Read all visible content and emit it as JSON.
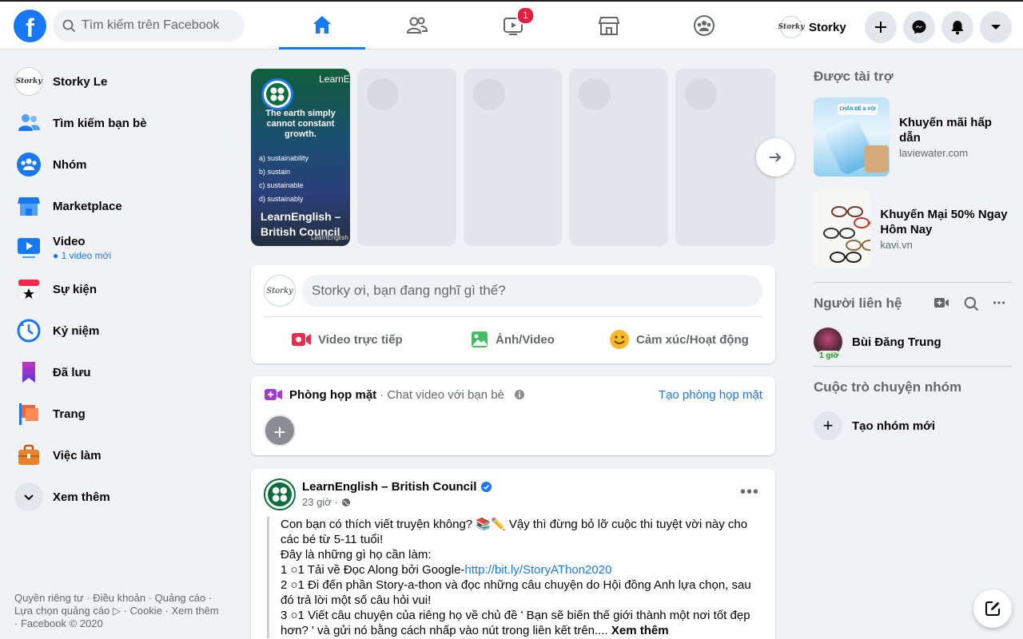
{
  "header": {
    "logo": "f",
    "search_placeholder": "Tìm kiếm trên Facebook",
    "watch_badge": "1",
    "profile_name": "Storky",
    "avatar_text": "Storky"
  },
  "left_nav": {
    "items": [
      {
        "label": "Storky Le",
        "icon": "avatar"
      },
      {
        "label": "Tìm kiếm bạn bè",
        "icon": "friends-icon"
      },
      {
        "label": "Nhóm",
        "icon": "groups-icon"
      },
      {
        "label": "Marketplace",
        "icon": "marketplace-icon"
      },
      {
        "label": "Video",
        "icon": "video-icon",
        "sub": "1 video mới"
      },
      {
        "label": "Sự kiện",
        "icon": "events-icon"
      },
      {
        "label": "Kỷ niệm",
        "icon": "memories-icon"
      },
      {
        "label": "Đã lưu",
        "icon": "saved-icon"
      },
      {
        "label": "Trang",
        "icon": "pages-icon"
      },
      {
        "label": "Việc làm",
        "icon": "jobs-icon"
      },
      {
        "label": "Xem thêm",
        "icon": "chevron-down-icon"
      }
    ],
    "footer": "Quyền riêng tư · Điều khoản · Quảng cáo · Lựa chọn quảng cáo ▷ · Cookie · Xem thêm · Facebook © 2020"
  },
  "stories": {
    "first": {
      "title": "LearnEnglish – British Council",
      "brand_text": "LearnE",
      "top_text": "The earth simply cannot constant growth.",
      "options": [
        "a) sustainability",
        "b) sustain",
        "c) sustainable",
        "d) sustainably"
      ],
      "small_brand": "LearnEnglish"
    }
  },
  "composer": {
    "placeholder": "Storky ơi, bạn đang nghĩ gì thế?",
    "live": "Video trực tiếp",
    "photo": "Ảnh/Video",
    "feeling": "Cảm xúc/Hoạt động"
  },
  "rooms": {
    "title": "Phòng họp mặt",
    "subtitle": "· Chat video với bạn bè",
    "create": "Tạo phòng họp mặt"
  },
  "post": {
    "author": "LearnEnglish – British Council",
    "time": "23 giờ ·",
    "line1": "Con bạn có thích viết truyện không? 📚✏️ Vậy thì đừng bỏ lỡ cuộc thi tuyệt vời này cho các bé từ 5-11 tuổi!",
    "line2": "Đây là những gì họ cần làm:",
    "step1_prefix": "1 ○1 Tải về Đọc Along bởi Google-",
    "step1_link": "http://bit.ly/StoryAThon2020",
    "step2": "2 ○1 Đi đến phần Story-a-thon và đọc những câu chuyện do Hội đồng Anh lựa chọn, sau đó trả lời một số câu hỏi vui!",
    "step3": "3 ○1 Viết câu chuyện của riêng họ về chủ đề ' Bạn sẽ biến thế giới thành một nơi tốt đẹp hơn? ' và gửi nó bằng cách nhấp vào nút trong liên kết trên....",
    "see_more": "Xem thêm"
  },
  "right": {
    "sponsored_title": "Được tài trợ",
    "ads": [
      {
        "title": "Khuyến mãi hấp dẫn",
        "url": "laviewater.com"
      },
      {
        "title": "Khuyến Mại 50% Ngay Hôm Nay",
        "url": "kavi.vn"
      }
    ],
    "ad1_banner": "CHẮN ĐẾ & VÒI",
    "contacts_title": "Người liên hệ",
    "contacts": [
      {
        "name": "Bùi Đăng Trung",
        "status": "1 giờ"
      }
    ],
    "group_title": "Cuộc trò chuyện nhóm",
    "new_group": "Tạo nhóm mới"
  },
  "colors": {
    "accent": "#1877f2",
    "badge": "#e41e3f",
    "background": "#f0f2f5"
  }
}
